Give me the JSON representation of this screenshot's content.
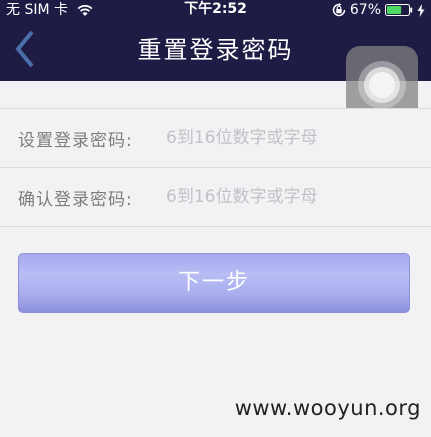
{
  "status_bar": {
    "carrier": "无 SIM 卡",
    "time": "下午2:52",
    "battery_percent": "67%",
    "battery_level": 0.67
  },
  "nav": {
    "title": "重置登录密码",
    "back_icon": "chevron-left-icon"
  },
  "form": {
    "password_label": "设置登录密码:",
    "password_placeholder": "6到16位数字或字母",
    "confirm_label": "确认登录密码:",
    "confirm_placeholder": "6到16位数字或字母"
  },
  "next_button": {
    "label": "下一步"
  },
  "watermark": "www.wooyun.org",
  "colors": {
    "nav_background": "#1e1b45",
    "page_background": "#f2f2f4",
    "button_gradient_top": "#a5a8ee",
    "button_gradient_bottom": "#8c90dc",
    "back_arrow": "#4a6fa8",
    "battery_fill": "#4cd964"
  }
}
